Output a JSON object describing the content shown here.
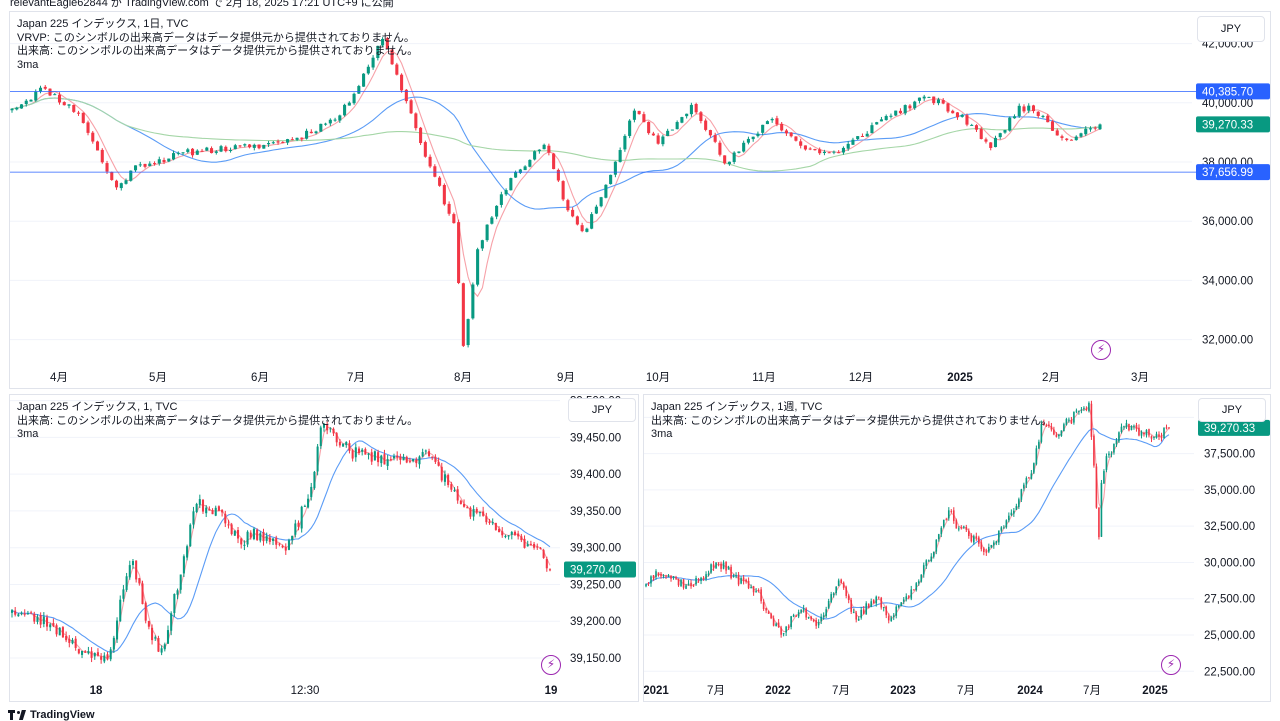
{
  "header": {
    "publish_info": "relevantEagle62844 が TradingView.com で 2月 18, 2025 17:21 UTC+9 に公開"
  },
  "footer": {
    "brand": "TradingView"
  },
  "colors": {
    "up": "#089981",
    "down": "#f23645",
    "ma_fast": "#f7a1a8",
    "ma_slow": "#5b9cf6",
    "ma_long": "#a5d6a7",
    "hline": "#2962ff",
    "bolt": "#9c27b0"
  },
  "panels": {
    "top": {
      "legend": [
        "Japan 225 インデックス, 1日, TVC",
        "VRVP: このシンボルの出来高データはデータ提供元から提供されておりません。",
        "出来高: このシンボルの出来高データはデータ提供元から提供されておりません。",
        "3ma"
      ],
      "currency": "JPY",
      "badges": {
        "upper": "40,385.70",
        "last": "39,270.33",
        "lower": "37,656.99"
      }
    },
    "bl": {
      "legend": [
        "Japan 225 インデックス, 1, TVC",
        "出来高: このシンボルの出来高データはデータ提供元から提供されておりません。",
        "3ma"
      ],
      "currency": "JPY",
      "badges": {
        "last": "39,270.40"
      }
    },
    "br": {
      "legend": [
        "Japan 225 インデックス, 1週, TVC",
        "出来高: このシンボルの出来高データはデータ提供元から提供されておりません。",
        "3ma"
      ],
      "currency": "JPY",
      "badges": {
        "last": "39,270.33"
      }
    }
  },
  "chart_data": [
    {
      "type": "candlestick",
      "title": "Japan 225 インデックス, 1日, TVC",
      "ylim": [
        30500,
        43000
      ],
      "y_ticks": [
        "32,000.00",
        "34,000.00",
        "36,000.00",
        "38,000.00",
        "40,000.00",
        "42,000.00"
      ],
      "x_ticks": [
        "4月",
        "5月",
        "6月",
        "7月",
        "8月",
        "9月",
        "10月",
        "11月",
        "12月",
        "2025",
        "2月",
        "3月"
      ],
      "horizontal_lines": [
        40385.7,
        37656.99
      ],
      "last_value": 39270.33,
      "anchors": [
        [
          "2024-03-18",
          39800
        ],
        [
          "2024-03-28",
          40500
        ],
        [
          "2024-04-08",
          39600
        ],
        [
          "2024-04-19",
          37100
        ],
        [
          "2024-04-26",
          37900
        ],
        [
          "2024-05-15",
          38400
        ],
        [
          "2024-05-31",
          38500
        ],
        [
          "2024-06-14",
          38800
        ],
        [
          "2024-06-28",
          39600
        ],
        [
          "2024-07-11",
          42200
        ],
        [
          "2024-07-18",
          40100
        ],
        [
          "2024-07-26",
          37700
        ],
        [
          "2024-08-02",
          35900
        ],
        [
          "2024-08-05",
          31500
        ],
        [
          "2024-08-09",
          35000
        ],
        [
          "2024-08-19",
          37400
        ],
        [
          "2024-08-30",
          38600
        ],
        [
          "2024-09-06",
          36400
        ],
        [
          "2024-09-11",
          35600
        ],
        [
          "2024-09-20",
          37700
        ],
        [
          "2024-09-27",
          39800
        ],
        [
          "2024-10-04",
          38600
        ],
        [
          "2024-10-15",
          40000
        ],
        [
          "2024-10-25",
          37900
        ],
        [
          "2024-11-08",
          39500
        ],
        [
          "2024-11-19",
          38400
        ],
        [
          "2024-11-29",
          38300
        ],
        [
          "2024-12-13",
          39500
        ],
        [
          "2024-12-27",
          40200
        ],
        [
          "2025-01-10",
          39200
        ],
        [
          "2025-01-15",
          38450
        ],
        [
          "2025-01-24",
          39900
        ],
        [
          "2025-01-31",
          39600
        ],
        [
          "2025-02-07",
          38700
        ],
        [
          "2025-02-14",
          39150
        ],
        [
          "2025-02-18",
          39270
        ]
      ],
      "series": [
        {
          "name": "3ma"
        }
      ]
    },
    {
      "type": "candlestick",
      "title": "Japan 225 インデックス, 1, TVC",
      "ylim": [
        39120,
        39505
      ],
      "y_ticks": [
        "39,150.00",
        "39,200.00",
        "39,250.00",
        "39,300.00",
        "39,350.00",
        "39,400.00",
        "39,450.00",
        "39,500.00"
      ],
      "x_ticks": [
        "18",
        "12:30",
        "19"
      ],
      "last_value": 39270.4,
      "anchors": [
        [
          0,
          39215
        ],
        [
          20,
          39195
        ],
        [
          40,
          39150
        ],
        [
          48,
          39148
        ],
        [
          60,
          39290
        ],
        [
          70,
          39175
        ],
        [
          76,
          39160
        ],
        [
          92,
          39360
        ],
        [
          105,
          39350
        ],
        [
          114,
          39310
        ],
        [
          125,
          39320
        ],
        [
          138,
          39295
        ],
        [
          150,
          39380
        ],
        [
          156,
          39470
        ],
        [
          170,
          39430
        ],
        [
          190,
          39420
        ],
        [
          210,
          39425
        ],
        [
          225,
          39360
        ],
        [
          245,
          39320
        ],
        [
          265,
          39300
        ],
        [
          270,
          39270
        ]
      ],
      "series": [
        {
          "name": "3ma"
        }
      ]
    },
    {
      "type": "candlestick",
      "title": "Japan 225 インデックス, 1週, TVC",
      "ylim": [
        21900,
        41400
      ],
      "y_ticks": [
        "22,500.00",
        "25,000.00",
        "27,500.00",
        "30,000.00",
        "32,500.00",
        "35,000.00",
        "37,500.00",
        "40,000.00"
      ],
      "x_ticks": [
        "2021",
        "7月",
        "2022",
        "7月",
        "2023",
        "7月",
        "2024",
        "7月",
        "2025"
      ],
      "last_value": 39270.33,
      "anchors": [
        [
          "2021-03-01",
          28500
        ],
        [
          "2021-04-01",
          29500
        ],
        [
          "2021-07-01",
          28300
        ],
        [
          "2021-09-15",
          30000
        ],
        [
          "2021-11-01",
          29000
        ],
        [
          "2022-01-01",
          28000
        ],
        [
          "2022-03-09",
          25000
        ],
        [
          "2022-05-01",
          26800
        ],
        [
          "2022-06-20",
          25800
        ],
        [
          "2022-08-15",
          28800
        ],
        [
          "2022-10-01",
          26000
        ],
        [
          "2022-12-01",
          27800
        ],
        [
          "2023-01-01",
          26000
        ],
        [
          "2023-03-01",
          28000
        ],
        [
          "2023-05-01",
          30500
        ],
        [
          "2023-06-16",
          33600
        ],
        [
          "2023-07-01",
          32800
        ],
        [
          "2023-10-01",
          30600
        ],
        [
          "2023-12-01",
          33300
        ],
        [
          "2024-02-01",
          36200
        ],
        [
          "2024-03-01",
          39900
        ],
        [
          "2024-04-01",
          38800
        ],
        [
          "2024-07-08",
          41000
        ],
        [
          "2024-08-05",
          31500
        ],
        [
          "2024-08-12",
          36000
        ],
        [
          "2024-09-01",
          37500
        ],
        [
          "2024-10-15",
          39500
        ],
        [
          "2024-12-01",
          39000
        ],
        [
          "2025-01-15",
          38600
        ],
        [
          "2025-02-14",
          39270
        ]
      ],
      "series": [
        {
          "name": "3ma"
        }
      ]
    }
  ]
}
